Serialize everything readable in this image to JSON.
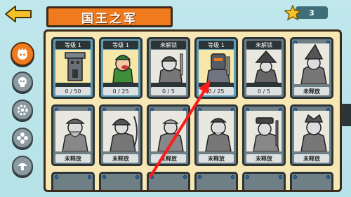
{
  "header": {
    "title": "国王之军",
    "back_icon": "back-arrow-icon",
    "stars": "3"
  },
  "sidebar": {
    "items": [
      {
        "icon": "army-icon",
        "active": true
      },
      {
        "icon": "skull-icon",
        "active": false
      },
      {
        "icon": "gear-icon",
        "active": false
      },
      {
        "icon": "flower-icon",
        "active": false
      },
      {
        "icon": "mushroom-icon",
        "active": false
      }
    ]
  },
  "cards": [
    {
      "header": "等级 1",
      "progress": "0 / 50",
      "stars_filled": 1,
      "unlocked": true,
      "portrait": "tower-icon"
    },
    {
      "header": "等级 1",
      "progress": "0 / 25",
      "stars_filled": 1,
      "unlocked": true,
      "portrait": "peasant-icon"
    },
    {
      "header": "未解锁",
      "progress": "0 / 5",
      "stars_filled": 0,
      "unlocked": false,
      "portrait": "knight-icon"
    },
    {
      "header": "等级 1",
      "progress": "0 / 25",
      "stars_filled": 1,
      "unlocked": true,
      "portrait": "armored-knight-icon"
    },
    {
      "header": "未解锁",
      "progress": "0 / 5",
      "stars_filled": 0,
      "unlocked": false,
      "portrait": "witch-icon"
    },
    {
      "header": "",
      "progress": "未释放",
      "stars_filled": 0,
      "unlocked": false,
      "portrait": "wizard-icon"
    },
    {
      "header": "",
      "progress": "未释放",
      "portrait": "viking-icon"
    },
    {
      "header": "",
      "progress": "未释放",
      "portrait": "archer-icon"
    },
    {
      "header": "",
      "progress": "未释放",
      "portrait": "elf-icon"
    },
    {
      "header": "",
      "progress": "未释放",
      "portrait": "paladin-icon"
    },
    {
      "header": "",
      "progress": "未释放",
      "portrait": "musketeer-icon"
    },
    {
      "header": "",
      "progress": "未释放",
      "portrait": "barbarian-icon"
    }
  ],
  "colors": {
    "accent": "#f07b1e",
    "panel": "#f6e7b4",
    "frame": "#3b2a1a",
    "unlocked_card": "#5e9eb6",
    "locked_card": "#6f7f86",
    "annotation_arrow": "#ff1a1a"
  }
}
